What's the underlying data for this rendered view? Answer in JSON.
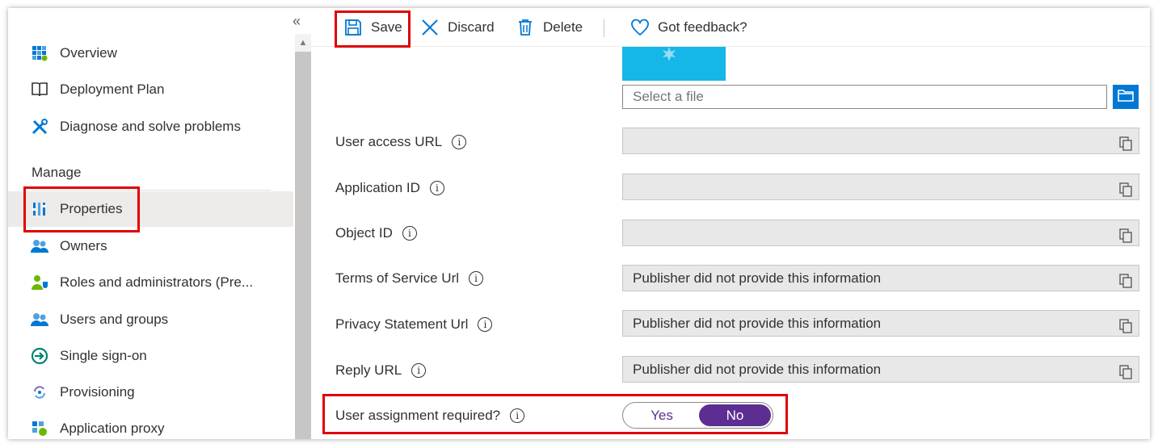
{
  "sidebar": {
    "collapse_glyph": "«",
    "items_top": [
      {
        "label": "Overview",
        "icon": "overview-grid-icon"
      },
      {
        "label": "Deployment Plan",
        "icon": "book-icon"
      },
      {
        "label": "Diagnose and solve problems",
        "icon": "wrench-cross-icon"
      }
    ],
    "section_label": "Manage",
    "items_manage": [
      {
        "label": "Properties",
        "icon": "properties-bars-icon",
        "active": true
      },
      {
        "label": "Owners",
        "icon": "people-icon"
      },
      {
        "label": "Roles and administrators (Pre...",
        "icon": "user-shield-icon"
      },
      {
        "label": "Users and groups",
        "icon": "people-icon"
      },
      {
        "label": "Single sign-on",
        "icon": "sign-in-arrow-icon"
      },
      {
        "label": "Provisioning",
        "icon": "sync-icon"
      },
      {
        "label": "Application proxy",
        "icon": "proxy-icon"
      }
    ]
  },
  "toolbar": {
    "save_label": "Save",
    "discard_label": "Discard",
    "delete_label": "Delete",
    "feedback_label": "Got feedback?"
  },
  "logo": {
    "file_placeholder": "Select a file"
  },
  "fields": [
    {
      "label": "User access URL",
      "value": ""
    },
    {
      "label": "Application ID",
      "value": ""
    },
    {
      "label": "Object ID",
      "value": ""
    },
    {
      "label": "Terms of Service Url",
      "value": "Publisher did not provide this information"
    },
    {
      "label": "Privacy Statement Url",
      "value": "Publisher did not provide this information"
    },
    {
      "label": "Reply URL",
      "value": "Publisher did not provide this information"
    }
  ],
  "assignment": {
    "label": "User assignment required?",
    "yes_label": "Yes",
    "no_label": "No",
    "selected": "No"
  },
  "colors": {
    "accent": "#0078d4",
    "toggle_selected": "#5c2e91",
    "highlight": "#e00000"
  }
}
